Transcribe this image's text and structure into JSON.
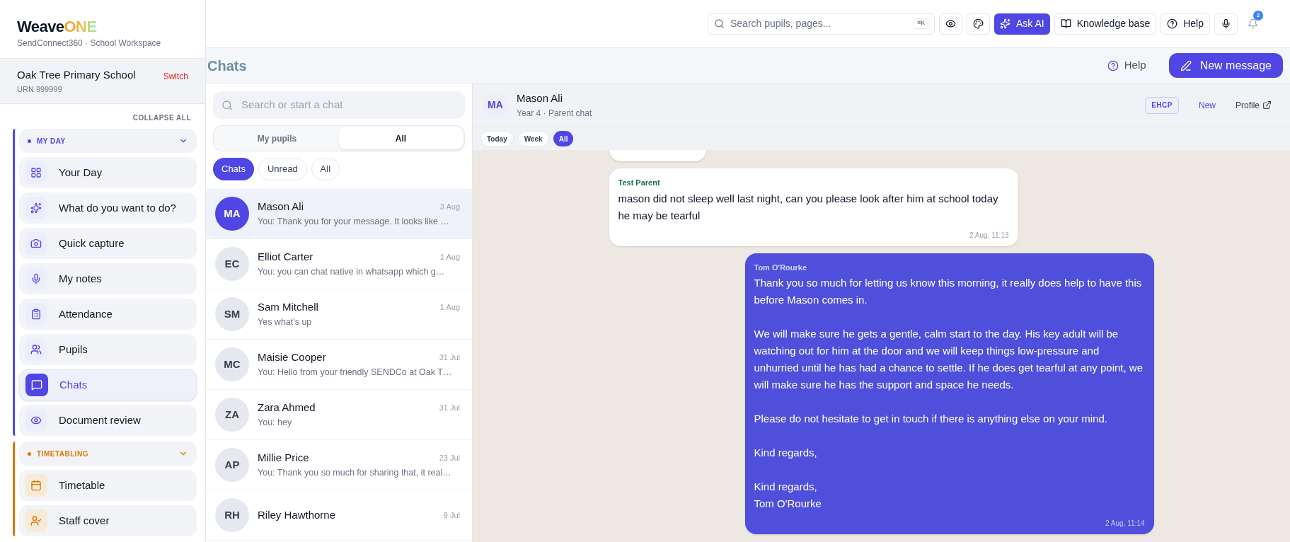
{
  "sidebar": {
    "logo": {
      "main": "Weave",
      "accent": "ONE"
    },
    "subtitle": "SendConnect360 · School Workspace",
    "school": {
      "name": "Oak Tree Primary School",
      "urn": "URN 999999",
      "switch": "Switch"
    },
    "collapse_all": "COLLAPSE ALL",
    "sections": [
      {
        "title": "MY DAY",
        "color": "#4f46e5",
        "expanded": true,
        "items": [
          {
            "label": "Your Day",
            "selected": false
          },
          {
            "label": "What do you want to do?",
            "selected": false
          },
          {
            "label": "Quick capture",
            "selected": false
          },
          {
            "label": "My notes",
            "selected": false
          },
          {
            "label": "Attendance",
            "selected": false
          },
          {
            "label": "Pupils",
            "selected": false
          },
          {
            "label": "Chats",
            "selected": true
          },
          {
            "label": "Document review",
            "selected": false
          }
        ]
      },
      {
        "title": "TIMETABLING",
        "color": "#d97706",
        "expanded": true,
        "items": [
          {
            "label": "Timetable",
            "selected": false
          },
          {
            "label": "Staff cover",
            "selected": false
          }
        ]
      }
    ]
  },
  "topbar": {
    "search": {
      "placeholder": "Search pupils, pages...",
      "shortcut": "⌘K"
    },
    "ask_ai": "Ask AI",
    "knowledge_base": "Knowledge base",
    "help": "Help",
    "notifications": "2"
  },
  "page_header": {
    "title": "Chats",
    "help": "Help",
    "new_message": "New message"
  },
  "chat_list": {
    "search": {
      "placeholder": "Search or start a chat"
    },
    "scope_tabs": [
      {
        "label": "My pupils",
        "selected": false
      },
      {
        "label": "All",
        "selected": true
      }
    ],
    "filters": [
      {
        "label": "Chats",
        "selected": true
      },
      {
        "label": "Unread",
        "selected": false
      },
      {
        "label": "All",
        "selected": false
      }
    ],
    "chats": [
      {
        "initials": "MA",
        "name": "Mason Ali",
        "date": "3 Aug",
        "preview": "You: Thank you for your message. It looks like …",
        "selected": true
      },
      {
        "initials": "EC",
        "name": "Elliot Carter",
        "date": "1 Aug",
        "preview": "You: you can chat native in whatsapp which g…",
        "selected": false
      },
      {
        "initials": "SM",
        "name": "Sam Mitchell",
        "date": "1 Aug",
        "preview": "Yes what's up",
        "selected": false
      },
      {
        "initials": "MC",
        "name": "Maisie Cooper",
        "date": "31 Jul",
        "preview": "You: Hello from your friendly SENDCo at Oak T…",
        "selected": false
      },
      {
        "initials": "ZA",
        "name": "Zara Ahmed",
        "date": "31 Jul",
        "preview": "You: hey",
        "selected": false
      },
      {
        "initials": "AP",
        "name": "Millie Price",
        "date": "23 Jul",
        "preview": "You: Thank you so much for sharing that, it real…",
        "selected": false
      },
      {
        "initials": "RH",
        "name": "Riley Hawthorne",
        "date": "9 Jul",
        "selected": false
      }
    ]
  },
  "conversation": {
    "initials": "MA",
    "name": "Mason Ali",
    "subtitle": "Year 4 · Parent chat",
    "badge": "EHCP",
    "new": "New",
    "profile": "Profile",
    "range_tabs": [
      {
        "label": "Today",
        "selected": false
      },
      {
        "label": "Week",
        "selected": false
      },
      {
        "label": "All",
        "selected": true
      }
    ],
    "messages": [
      {
        "kind": "incoming",
        "sender": "Test Parent",
        "paragraphs": [
          "mason did not sleep well last night, can you please look after him at school today he may be tearful"
        ],
        "time": "2 Aug, 11:13"
      },
      {
        "kind": "outgoing",
        "sender": "Tom O'Rourke",
        "paragraphs": [
          "Thank you so much for letting us know this morning, it really does help to have this before Mason comes in.",
          "We will make sure he gets a gentle, calm start to the day. His key adult will be watching out for him at the door and we will keep things low-pressure and unhurried until he has had a chance to settle. If he does get tearful at any point, we will make sure he has the support and space he needs.",
          "Please do not hesitate to get in touch if there is anything else on your mind.",
          "Kind regards,",
          "Kind regards,\nTom O'Rourke"
        ],
        "time": "2 Aug, 11:14"
      }
    ]
  }
}
